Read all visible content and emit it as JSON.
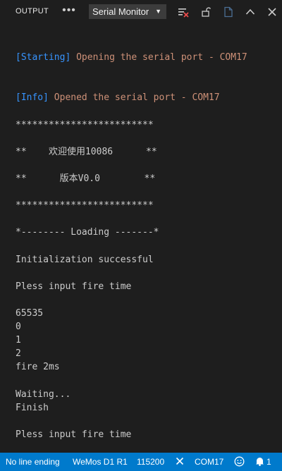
{
  "panel": {
    "tab_label": "OUTPUT",
    "more_label": "•••",
    "channel": "Serial Monitor"
  },
  "console": {
    "starting_tag": "[Starting]",
    "starting_msg": " Opening the serial port - COM17",
    "info_tag": "[Info]",
    "info_msg": " Opened the serial port - COM17",
    "lines": [
      "*************************",
      "",
      "**    欢迎使用10086      **",
      "",
      "**      版本V0.0        **",
      "",
      "*************************",
      "",
      "*-------- Loading -------*",
      "",
      "Initialization successful",
      "",
      "Pless input fire time",
      "",
      "65535",
      "0",
      "1",
      "2",
      "fire 2ms",
      "",
      "Waiting...",
      "Finish",
      "",
      "Pless input fire time"
    ]
  },
  "status_bar": {
    "line_ending": "No line ending",
    "board": "WeMos D1 R1",
    "baud_rate": "115200",
    "port": "COM17",
    "notifications": "1"
  },
  "colors": {
    "tag": "#3794ff",
    "message": "#ce9178",
    "status_bar": "#007acc"
  }
}
